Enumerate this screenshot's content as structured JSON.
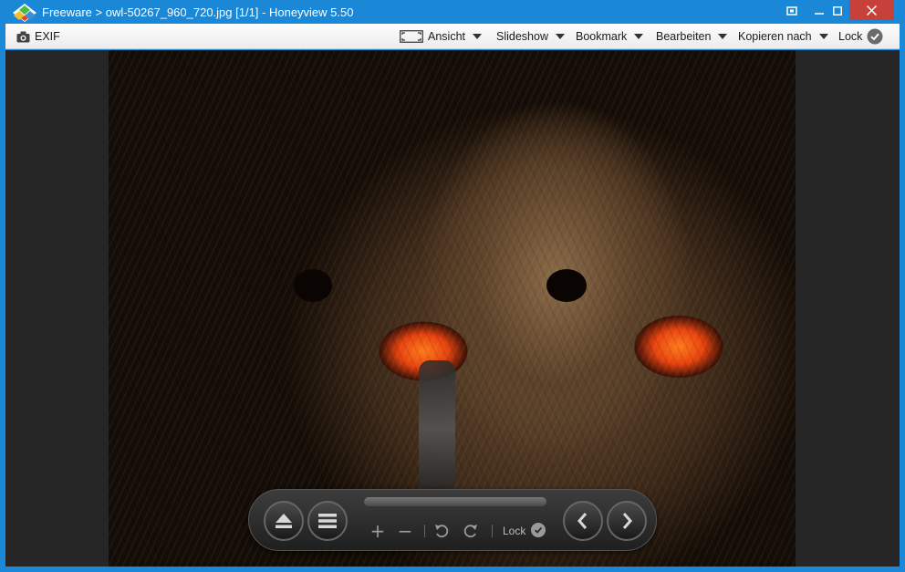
{
  "window": {
    "title": "Freeware > owl-50267_960_720.jpg [1/1] - Honeyview 5.50",
    "accent_color": "#1a87d7",
    "close_color": "#c7403a",
    "controls": [
      "fit-icon",
      "minimize-icon",
      "maximize-icon",
      "close-icon"
    ]
  },
  "toolbar": {
    "exif_label": "EXIF",
    "ansicht_label": "Ansicht",
    "slideshow_label": "Slideshow",
    "bookmark_label": "Bookmark",
    "bearbeiten_label": "Bearbeiten",
    "kopieren_label": "Kopieren nach",
    "lock_label": "Lock"
  },
  "controlbar": {
    "icons": [
      "eject-icon",
      "menu-icon",
      "zoom-in-icon",
      "zoom-out-icon",
      "rotate-left-icon",
      "rotate-right-icon",
      "prev-icon",
      "next-icon"
    ],
    "plus": "+",
    "minus": "−",
    "lock_label": "Lock"
  }
}
